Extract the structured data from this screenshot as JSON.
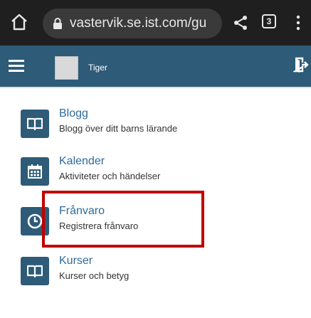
{
  "browser": {
    "url": "vastervik.se.ist.com/gu",
    "tab_count": "3"
  },
  "header": {
    "user_name": "Tiger"
  },
  "menu": [
    {
      "title": "Blogg",
      "subtitle": "Blogg över ditt barns lärande",
      "icon": "book-icon"
    },
    {
      "title": "Kalender",
      "subtitle": "Aktiviteter och händelser",
      "icon": "calendar-icon"
    },
    {
      "title": "Frånvaro",
      "subtitle": "Registrera frånvaro",
      "icon": "clock-icon"
    },
    {
      "title": "Kurser",
      "subtitle": "Kurser och betyg",
      "icon": "book-icon"
    }
  ],
  "colors": {
    "header_bg": "#2d5b78",
    "tile_bg": "#2d5b78",
    "title_text": "#2e6a9a",
    "highlight": "#c00000"
  }
}
